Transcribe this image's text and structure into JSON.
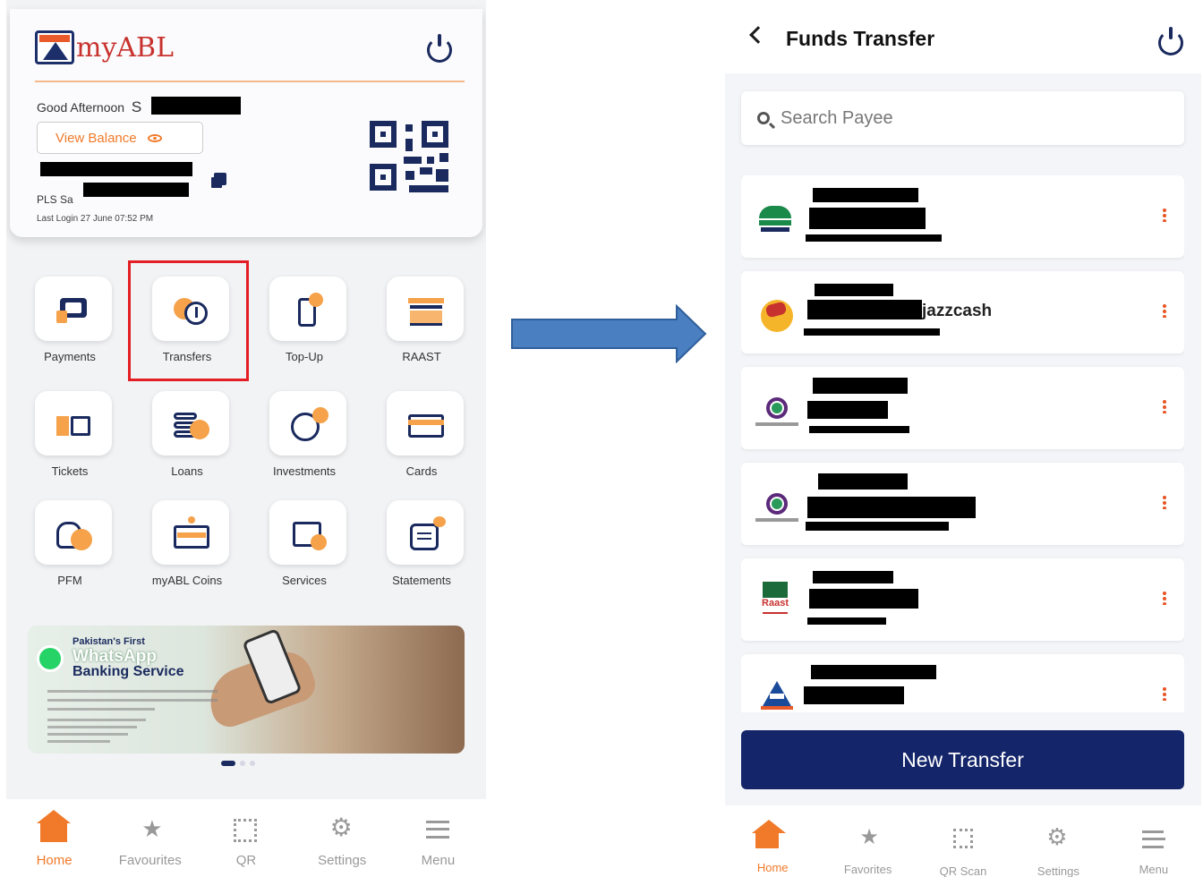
{
  "left": {
    "app_name": "myABL",
    "greeting": "Good Afternoon",
    "greeting_initial": "S",
    "view_balance": "View Balance",
    "account_type": "PLS Sa",
    "last_login": "Last Login 27 June 07:52 PM",
    "tiles": [
      {
        "label": "Payments",
        "icon": "payments-icon"
      },
      {
        "label": "Transfers",
        "icon": "transfers-icon"
      },
      {
        "label": "Top-Up",
        "icon": "top-up-icon"
      },
      {
        "label": "RAAST",
        "icon": "raast-icon"
      },
      {
        "label": "Tickets",
        "icon": "tickets-icon"
      },
      {
        "label": "Loans",
        "icon": "loans-icon"
      },
      {
        "label": "Investments",
        "icon": "investments-icon"
      },
      {
        "label": "Cards",
        "icon": "cards-icon"
      },
      {
        "label": "PFM",
        "icon": "pfm-icon"
      },
      {
        "label": "myABL Coins",
        "icon": "coins-icon"
      },
      {
        "label": "Services",
        "icon": "services-icon"
      },
      {
        "label": "Statements",
        "icon": "statements-icon"
      }
    ],
    "banner": {
      "line1": "Pakistan's First",
      "line2": "WhatsApp",
      "line3": "Banking Service"
    },
    "nav": [
      "Home",
      "Favourites",
      "QR",
      "Settings",
      "Menu"
    ]
  },
  "right": {
    "title": "Funds Transfer",
    "search_placeholder": "Search Payee",
    "payees": [
      {
        "logo": "MCB",
        "visible_text": ""
      },
      {
        "logo": "JazzCash",
        "visible_text": "jazzcash"
      },
      {
        "logo": "Meezan Bank",
        "visible_text": ""
      },
      {
        "logo": "Meezan Bank",
        "visible_text": ""
      },
      {
        "logo": "Raast",
        "visible_text": ""
      },
      {
        "logo": "Allied Bank",
        "visible_text": ""
      }
    ],
    "new_transfer": "New Transfer",
    "nav": [
      "Home",
      "Favorites",
      "QR Scan",
      "Settings",
      "Menu"
    ]
  },
  "colors": {
    "accent": "#f07a2a",
    "navy": "#14256a",
    "highlight": "#e31e24",
    "arrow": "#4a7fc1"
  }
}
